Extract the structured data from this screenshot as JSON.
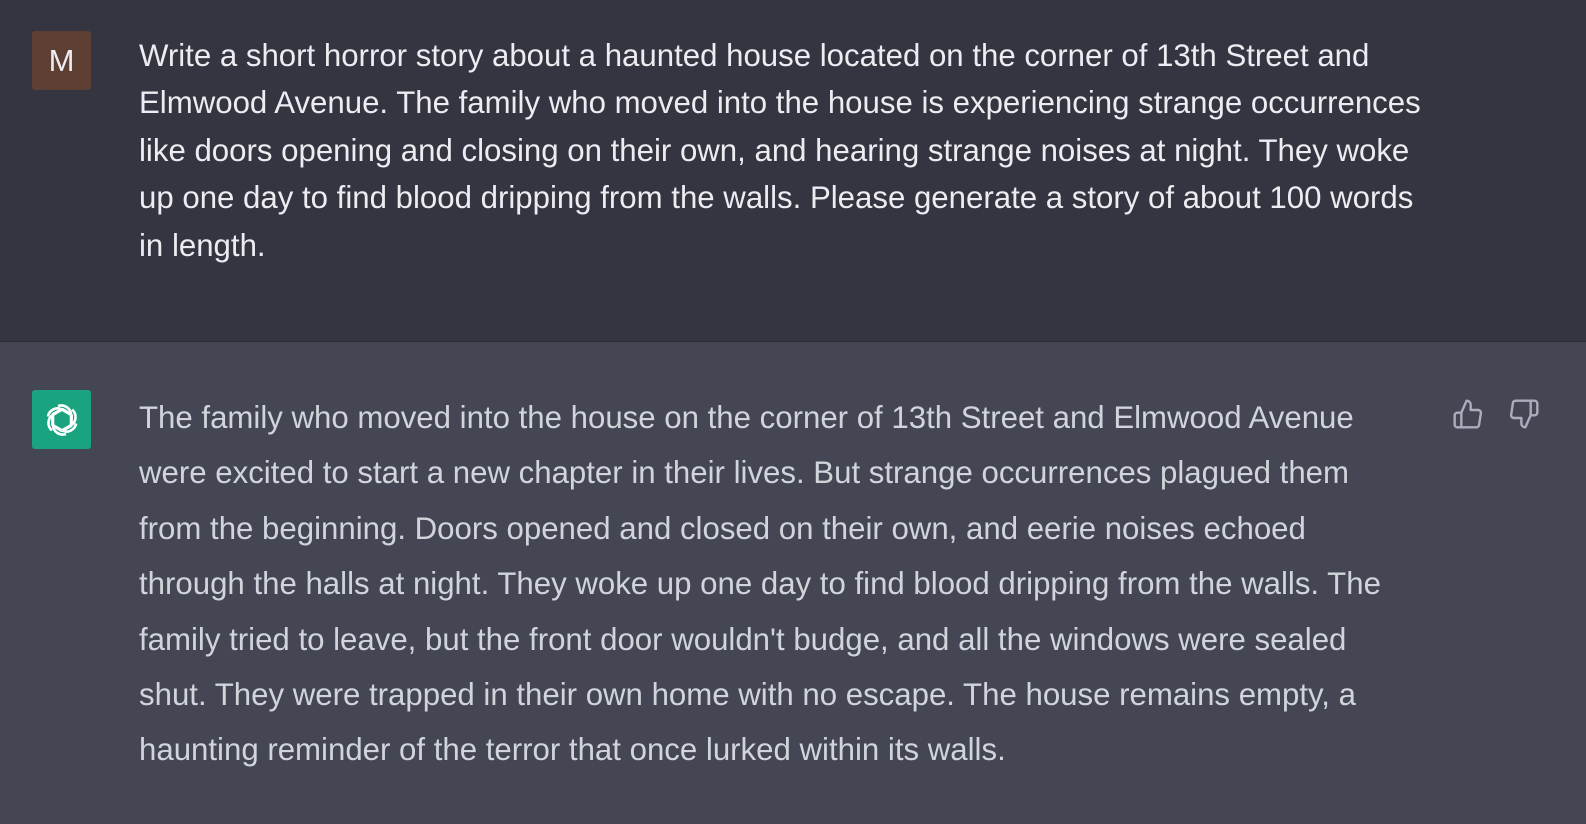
{
  "user_message": {
    "avatar_letter": "M",
    "avatar_color": "#5d3f33",
    "text": "Write a short horror story about a haunted house located on the corner of 13th Street and Elmwood Avenue. The family who moved into the house is experiencing strange occurrences like doors opening and closing on their own, and hearing strange noises at night. They woke up one day to find blood dripping from the walls. Please generate a story of about 100 words in length."
  },
  "assistant_message": {
    "avatar_icon": "openai-logo-icon",
    "avatar_color": "#19a37f",
    "text": "The family who moved into the house on the corner of 13th Street and Elmwood Avenue were excited to start a new chapter in their lives. But strange occurrences plagued them from the beginning. Doors opened and closed on their own, and eerie noises echoed through the halls at night. They woke up one day to find blood dripping from the walls. The family tried to leave, but the front door wouldn't budge, and all the windows were sealed shut. They were trapped in their own home with no escape. The house remains empty, a haunting reminder of the terror that once lurked within its walls.",
    "feedback_icons": [
      "thumbs-up-icon",
      "thumbs-down-icon"
    ]
  },
  "colors": {
    "user_bg": "#343541",
    "assistant_bg": "#444654",
    "user_text": "#ececf1",
    "assistant_text": "#d1d5db"
  }
}
